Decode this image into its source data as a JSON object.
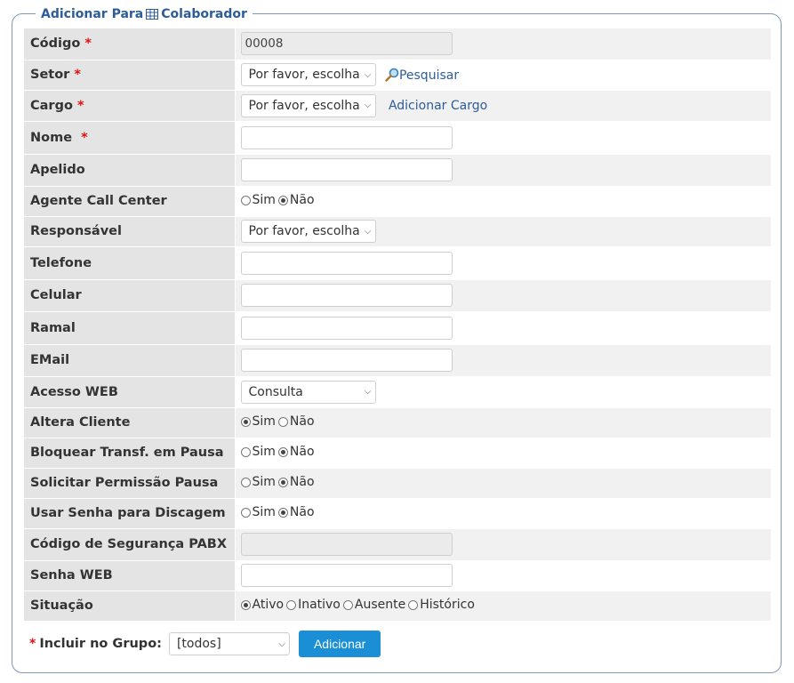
{
  "legend": {
    "prefix": "Adicionar Para",
    "suffix": "Colaborador"
  },
  "required_mark": "*",
  "fields": {
    "codigo": {
      "label": "Código",
      "value": "00008"
    },
    "setor": {
      "label": "Setor",
      "select": "Por favor, escolha",
      "link": "Pesquisar"
    },
    "cargo": {
      "label": "Cargo",
      "select": "Por favor, escolha",
      "link": "Adicionar Cargo"
    },
    "nome": {
      "label": "Nome",
      "value": ""
    },
    "apelido": {
      "label": "Apelido",
      "value": ""
    },
    "agente": {
      "label": "Agente Call Center",
      "options": [
        "Sim",
        "Não"
      ],
      "selected": "Não"
    },
    "responsavel": {
      "label": "Responsável",
      "select": "Por favor, escolha"
    },
    "telefone": {
      "label": "Telefone",
      "value": ""
    },
    "celular": {
      "label": "Celular",
      "value": ""
    },
    "ramal": {
      "label": "Ramal",
      "value": ""
    },
    "email": {
      "label": "EMail",
      "value": ""
    },
    "acesso_web": {
      "label": "Acesso WEB",
      "select": "Consulta"
    },
    "altera_cliente": {
      "label": "Altera Cliente",
      "options": [
        "Sim",
        "Não"
      ],
      "selected": "Sim"
    },
    "bloquear": {
      "label": "Bloquear Transf. em Pausa",
      "options": [
        "Sim",
        "Não"
      ],
      "selected": "Não"
    },
    "solicitar": {
      "label": "Solicitar Permissão Pausa",
      "options": [
        "Sim",
        "Não"
      ],
      "selected": "Não"
    },
    "usar_senha": {
      "label": "Usar Senha para Discagem",
      "options": [
        "Sim",
        "Não"
      ],
      "selected": "Não"
    },
    "codigo_seg": {
      "label": "Código de Segurança PABX",
      "value": ""
    },
    "senha_web": {
      "label": "Senha WEB",
      "value": ""
    },
    "situacao": {
      "label": "Situação",
      "options": [
        "Ativo",
        "Inativo",
        "Ausente",
        "Histórico"
      ],
      "selected": "Ativo"
    }
  },
  "footer": {
    "label": "Incluir no Grupo:",
    "select": "[todos]",
    "button": "Adicionar"
  },
  "colors": {
    "accent": "#2c5d99",
    "button": "#1a8fd6",
    "required": "#d11111",
    "label_bg": "#e4e4e4"
  },
  "icons": {
    "legend": "table-grid-icon",
    "search": "magnifier-icon"
  }
}
